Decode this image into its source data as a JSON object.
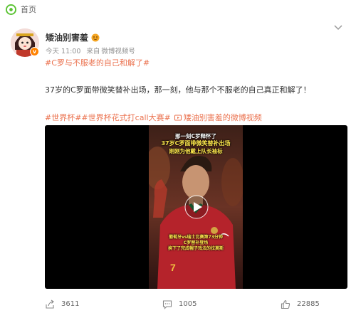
{
  "nav": {
    "home_label": "首页"
  },
  "post": {
    "author": "矮油别害羞",
    "badge": "v",
    "time": "今天 11:00",
    "source_prefix": "来自",
    "source": "微博视频号",
    "topic": "#C罗与不服老的自己和解了#",
    "body": "37岁的C罗面带微笑替补出场，那一刻，他与那个不服老的自己真正和解了！",
    "tags": "#世界杯##世界杯花式打call大赛#",
    "video_link": "矮油别害羞的微博视频"
  },
  "video": {
    "overlay_top_1": "那一刻C罗释怀了",
    "overlay_top_2": "37岁C罗面带微笑替补出场",
    "overlay_top_3": "刚刚为他戴上队长袖标",
    "overlay_bottom_1": "葡萄牙vs瑞士比赛第73分钟",
    "overlay_bottom_2": "C罗替补登场",
    "overlay_bottom_3": "换下了完成帽子戏法的拉莫斯"
  },
  "actions": {
    "share": "3611",
    "comment": "1005",
    "like": "22885"
  },
  "colors": {
    "accent": "#eb7350",
    "brand": "#ff8200",
    "text": "#333333",
    "meta": "#939393"
  }
}
